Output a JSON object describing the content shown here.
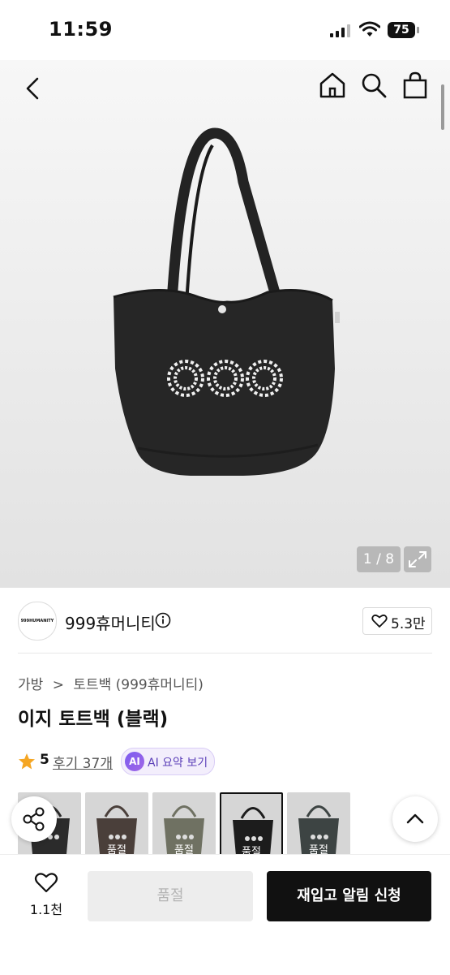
{
  "status": {
    "time": "11:59",
    "battery": "75"
  },
  "gallery": {
    "counter": "1 / 8"
  },
  "brand": {
    "logo_text": "999HUMANITY",
    "name": "999휴머니티",
    "likes": "5.3만"
  },
  "breadcrumb": {
    "category": "가방",
    "separator": ">",
    "subcategory": "토트백 (999휴머니티)"
  },
  "product": {
    "title": "이지 토트백 (블랙)",
    "rating": "5",
    "reviews": "후기 37개",
    "ai_badge": "AI",
    "ai_summary": "AI 요약 보기"
  },
  "variants": [
    {
      "color": "#2b2b2b",
      "sold": ""
    },
    {
      "color": "#4a3f3a",
      "sold": "품절"
    },
    {
      "color": "#6f7162",
      "sold": "품절"
    },
    {
      "color": "#1c1c1c",
      "sold": "품절"
    },
    {
      "color": "#3d4443",
      "sold": "품절"
    }
  ],
  "bottom": {
    "wish_count": "1.1천",
    "soldout_label": "품절",
    "restock_label": "재입고 알림 신청"
  }
}
